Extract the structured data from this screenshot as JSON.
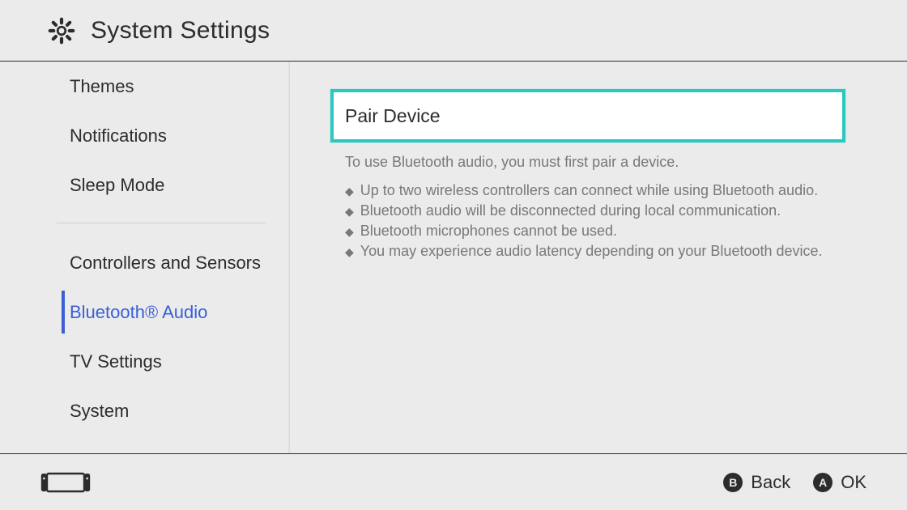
{
  "header": {
    "title": "System Settings"
  },
  "sidebar": {
    "items": [
      {
        "label": "Themes",
        "selected": false
      },
      {
        "label": "Notifications",
        "selected": false
      },
      {
        "label": "Sleep Mode",
        "selected": false
      },
      {
        "label": "Controllers and Sensors",
        "selected": false
      },
      {
        "label": "Bluetooth® Audio",
        "selected": true
      },
      {
        "label": "TV Settings",
        "selected": false
      },
      {
        "label": "System",
        "selected": false
      }
    ],
    "dividerAfterIndex": 2
  },
  "content": {
    "pairButtonLabel": "Pair Device",
    "instruction": "To use Bluetooth audio, you must first pair a device.",
    "bullets": [
      "Up to two wireless controllers can connect while using Bluetooth audio.",
      "Bluetooth audio will be disconnected during local communication.",
      "Bluetooth microphones cannot be used.",
      "You may experience audio latency depending on your Bluetooth device."
    ]
  },
  "footer": {
    "hints": [
      {
        "button": "B",
        "label": "Back"
      },
      {
        "button": "A",
        "label": "OK"
      }
    ]
  }
}
